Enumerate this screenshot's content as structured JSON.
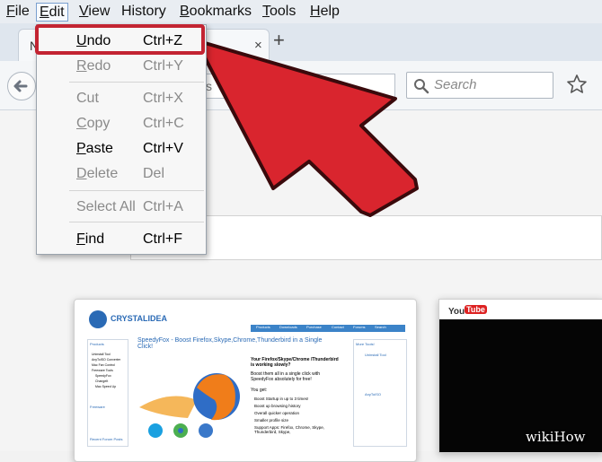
{
  "menubar": {
    "items": [
      "File",
      "Edit",
      "View",
      "History",
      "Bookmarks",
      "Tools",
      "Help"
    ]
  },
  "tabs": [
    {
      "label": "N",
      "close": "×"
    }
  ],
  "newtab_label": "+",
  "search": {
    "placeholder": "Search"
  },
  "urlbar_ghost": "s",
  "edit_menu": {
    "items": [
      {
        "label": "Undo",
        "shortcut": "Ctrl+Z",
        "enabled": true
      },
      {
        "label": "Redo",
        "shortcut": "Ctrl+Y",
        "enabled": false
      },
      {
        "label": "Cut",
        "shortcut": "Ctrl+X",
        "enabled": false
      },
      {
        "label": "Copy",
        "shortcut": "Ctrl+C",
        "enabled": false
      },
      {
        "label": "Paste",
        "shortcut": "Ctrl+V",
        "enabled": true
      },
      {
        "label": "Delete",
        "shortcut": "Del",
        "enabled": false
      },
      {
        "label": "Select All",
        "shortcut": "Ctrl+A",
        "enabled": false
      },
      {
        "label": "Find",
        "shortcut": "Ctrl+F",
        "enabled": true
      }
    ]
  },
  "thumbnails": {
    "crystalidea": {
      "logo": "CRYSTALIDEA",
      "nav": [
        "Products",
        "Downloads",
        "Purchase",
        "Contact",
        "Forums",
        "Search"
      ],
      "headline": "SpeedyFox - Boost Firefox,Skype,Chrome,Thunderbird in a Single Click!",
      "question": "Your Firefox/Skype/Chrome /Thunderbird is working slowly?",
      "answer": "Boost them all in a single click with SpeedyFox absolutely for free!",
      "you_get": "You get:",
      "benefits": [
        "Boost Startup in up to 3 times!",
        "Boost up browsing history",
        "Overall quicker operation",
        "Smaller profile size",
        "Support Apps: Firefox, Chrome, Skype, Thunderbird, Skype,"
      ],
      "sidebar_title": "Products",
      "sidebar_items": [
        "Uninstall Tool",
        "AnyToISO Converter",
        "Mac Fan Control",
        "Freeware Tools",
        "SpeedyFox",
        "ChangeIt",
        "Mac Speed Up"
      ],
      "sidebar_title2": "Freeware",
      "sidebar_title3": "Recent Forum Posts",
      "right_title": "More Tools!",
      "right_items": [
        "Uninstall Tool",
        "AnyToISO"
      ]
    },
    "youtube": {
      "logo_pre": "You",
      "logo_box": "Tube"
    }
  },
  "watermark": "wikiHow",
  "colors": {
    "highlight_red": "#c32432",
    "arrow_red": "#d9252e",
    "menubar_bg": "#e9edf2",
    "firefox_orange": "#f07d1a"
  },
  "icons": [
    "back-arrow-icon",
    "search-icon",
    "bookmark-star-icon",
    "mouse-cursor-icon",
    "skype-icon",
    "chrome-icon",
    "thunderbird-icon",
    "firefox-icon"
  ]
}
